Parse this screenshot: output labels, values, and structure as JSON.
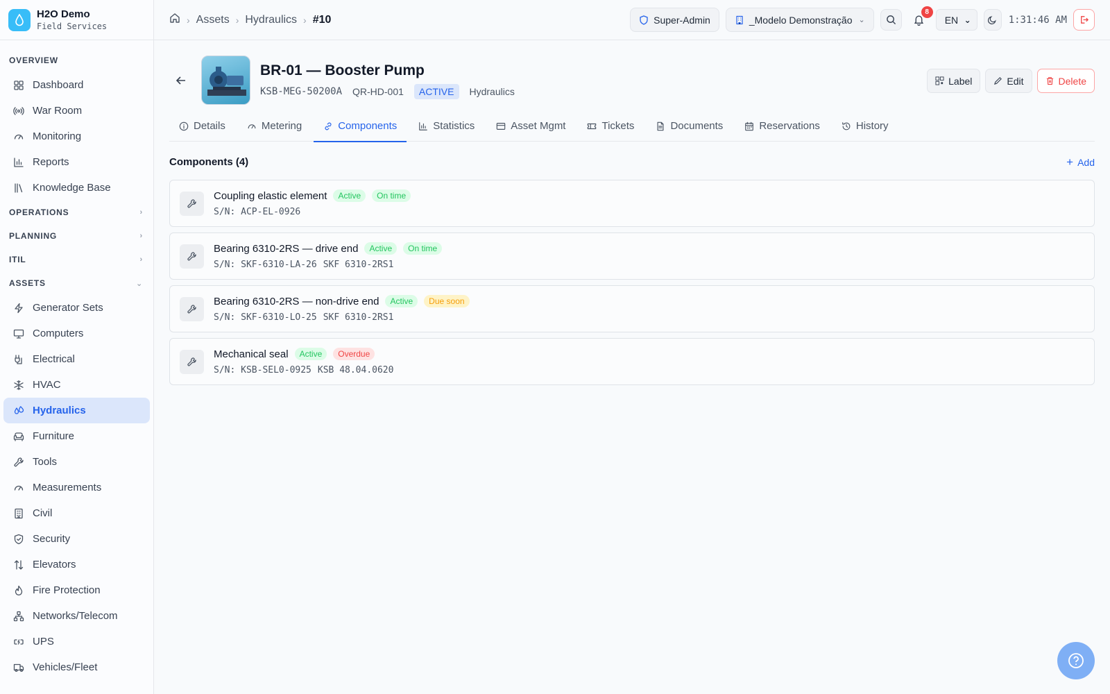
{
  "brand": {
    "title": "H2O Demo",
    "subtitle": "Field Services"
  },
  "sidebar": {
    "overview_label": "OVERVIEW",
    "overview": [
      {
        "label": "Dashboard",
        "icon": "dashboard-icon"
      },
      {
        "label": "War Room",
        "icon": "broadcast-icon"
      },
      {
        "label": "Monitoring",
        "icon": "gauge-icon"
      },
      {
        "label": "Reports",
        "icon": "bar-chart-icon"
      },
      {
        "label": "Knowledge Base",
        "icon": "library-icon"
      }
    ],
    "operations_label": "OPERATIONS",
    "planning_label": "PLANNING",
    "itil_label": "ITIL",
    "assets_label": "ASSETS",
    "assets": [
      {
        "label": "Generator Sets",
        "icon": "bolt-icon"
      },
      {
        "label": "Computers",
        "icon": "monitor-icon"
      },
      {
        "label": "Electrical",
        "icon": "plug-icon"
      },
      {
        "label": "HVAC",
        "icon": "snowflake-icon"
      },
      {
        "label": "Hydraulics",
        "icon": "droplets-icon",
        "active": true
      },
      {
        "label": "Furniture",
        "icon": "sofa-icon"
      },
      {
        "label": "Tools",
        "icon": "wrench-icon"
      },
      {
        "label": "Measurements",
        "icon": "gauge-icon"
      },
      {
        "label": "Civil",
        "icon": "building-icon"
      },
      {
        "label": "Security",
        "icon": "shield-icon"
      },
      {
        "label": "Elevators",
        "icon": "arrows-up-down-icon"
      },
      {
        "label": "Fire Protection",
        "icon": "flame-icon"
      },
      {
        "label": "Networks/Telecom",
        "icon": "network-icon"
      },
      {
        "label": "UPS",
        "icon": "battery-icon"
      },
      {
        "label": "Vehicles/Fleet",
        "icon": "truck-icon"
      }
    ]
  },
  "topbar": {
    "breadcrumb": [
      "Assets",
      "Hydraulics",
      "#10"
    ],
    "role": "Super-Admin",
    "tenant": "_Modelo Demonstração",
    "notifications": "8",
    "language": "EN",
    "clock": "1:31:46 AM"
  },
  "asset": {
    "title": "BR-01 — Booster Pump",
    "model": "KSB-MEG-50200A",
    "qr": "QR-HD-001",
    "status": "ACTIVE",
    "category": "Hydraulics"
  },
  "actions": {
    "label": "Label",
    "edit": "Edit",
    "delete": "Delete"
  },
  "tabs": [
    {
      "label": "Details",
      "icon": "info-icon"
    },
    {
      "label": "Metering",
      "icon": "gauge-icon"
    },
    {
      "label": "Components",
      "icon": "link-icon",
      "active": true
    },
    {
      "label": "Statistics",
      "icon": "bar-chart-icon"
    },
    {
      "label": "Asset Mgmt",
      "icon": "card-icon"
    },
    {
      "label": "Tickets",
      "icon": "ticket-icon"
    },
    {
      "label": "Documents",
      "icon": "document-icon"
    },
    {
      "label": "Reservations",
      "icon": "calendar-icon"
    },
    {
      "label": "History",
      "icon": "history-icon"
    }
  ],
  "components": {
    "heading": "Components (4)",
    "add_label": "Add",
    "items": [
      {
        "name": "Coupling elastic element",
        "status": "Active",
        "due": "On time",
        "due_color": "green",
        "sn": "S/N: ACP-EL-0926",
        "extra": ""
      },
      {
        "name": "Bearing 6310-2RS — drive end",
        "status": "Active",
        "due": "On time",
        "due_color": "green",
        "sn": "S/N: SKF-6310-LA-26",
        "extra": "SKF 6310-2RS1"
      },
      {
        "name": "Bearing 6310-2RS — non-drive end",
        "status": "Active",
        "due": "Due soon",
        "due_color": "yellow",
        "sn": "S/N: SKF-6310-LO-25",
        "extra": "SKF 6310-2RS1"
      },
      {
        "name": "Mechanical seal",
        "status": "Active",
        "due": "Overdue",
        "due_color": "red",
        "sn": "S/N: KSB-SEL0-0925",
        "extra": "KSB 48.04.0620"
      }
    ]
  },
  "colors": {
    "accent": "#2563eb",
    "brand": "#38bdf8",
    "active_bg": "#dbe6fb"
  }
}
